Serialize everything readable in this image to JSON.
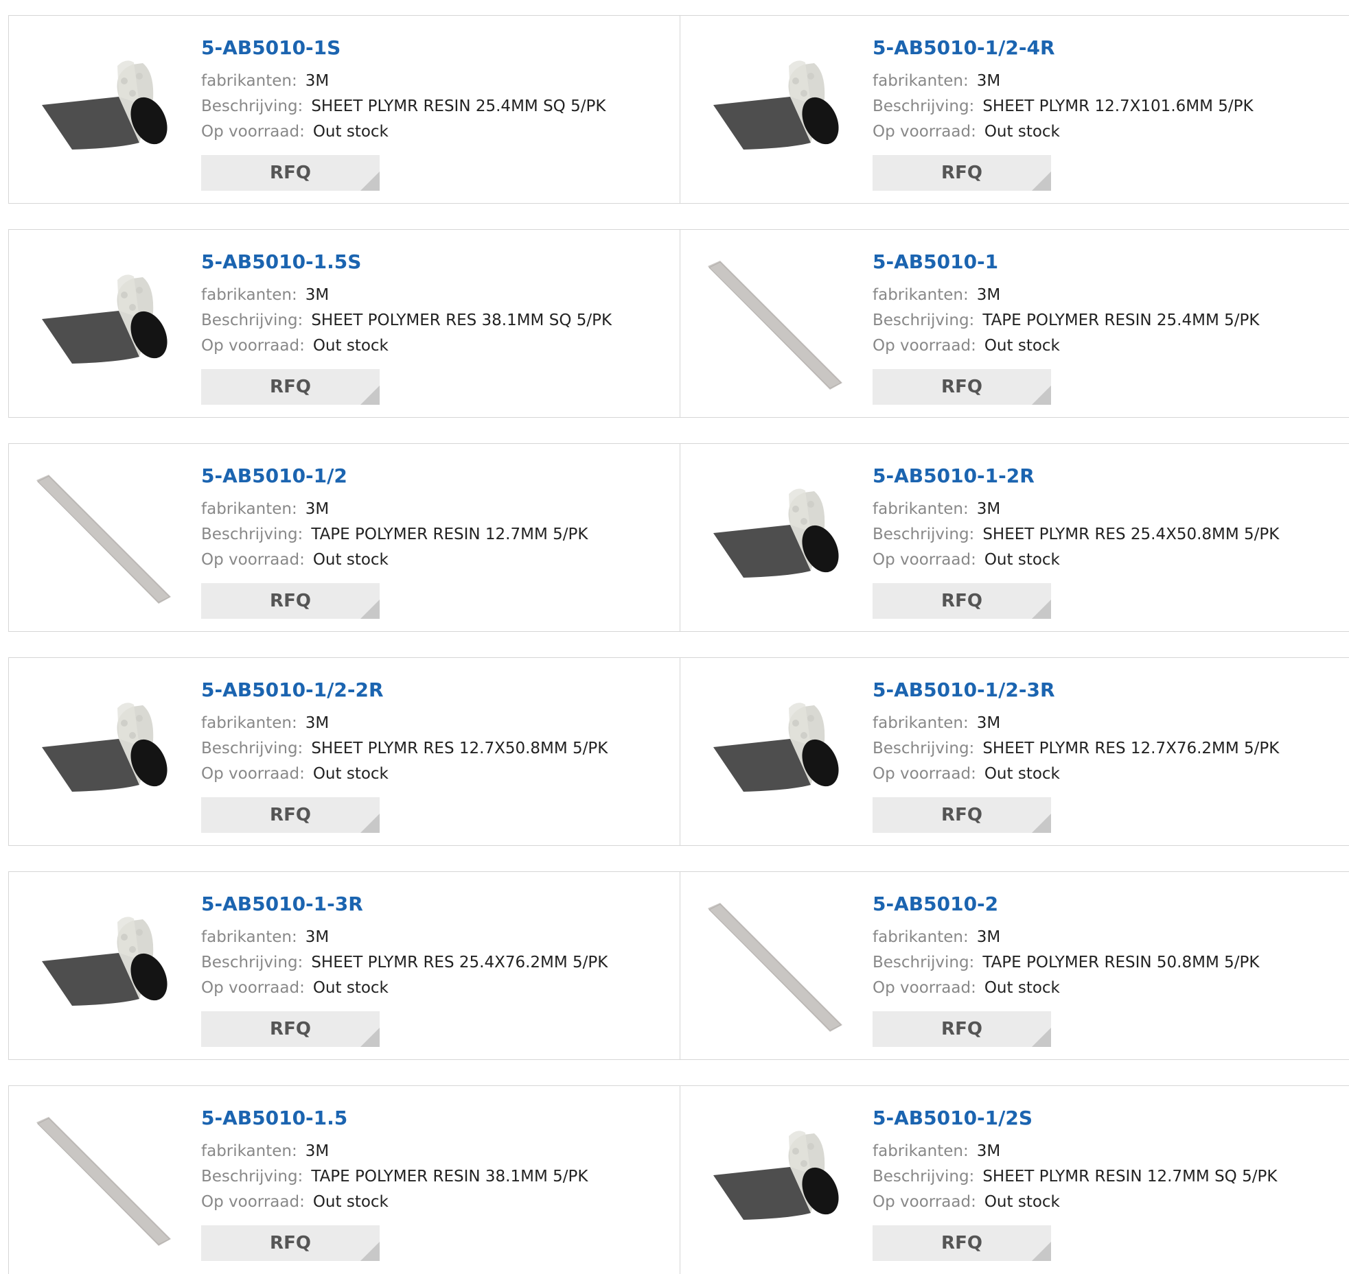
{
  "labels": {
    "manufacturer": "fabrikanten:",
    "description": "Beschrijving:",
    "stock": "Op voorraad:",
    "rfq_button": "RFQ"
  },
  "products": [
    {
      "pn": "5-AB5010-1S",
      "manufacturer": "3M",
      "description": "SHEET PLYMR RESIN 25.4MM SQ 5/PK",
      "stock": "Out stock",
      "image": "sheet-roll"
    },
    {
      "pn": "5-AB5010-1/2-4R",
      "manufacturer": "3M",
      "description": "SHEET PLYMR 12.7X101.6MM 5/PK",
      "stock": "Out stock",
      "image": "sheet-roll"
    },
    {
      "pn": "5-AB5010-1.5S",
      "manufacturer": "3M",
      "description": "SHEET POLYMER RES 38.1MM SQ 5/PK",
      "stock": "Out stock",
      "image": "sheet-roll"
    },
    {
      "pn": "5-AB5010-1",
      "manufacturer": "3M",
      "description": "TAPE POLYMER RESIN 25.4MM 5/PK",
      "stock": "Out stock",
      "image": "tape-strip"
    },
    {
      "pn": "5-AB5010-1/2",
      "manufacturer": "3M",
      "description": "TAPE POLYMER RESIN 12.7MM 5/PK",
      "stock": "Out stock",
      "image": "tape-strip"
    },
    {
      "pn": "5-AB5010-1-2R",
      "manufacturer": "3M",
      "description": "SHEET PLYMR RES 25.4X50.8MM 5/PK",
      "stock": "Out stock",
      "image": "sheet-roll"
    },
    {
      "pn": "5-AB5010-1/2-2R",
      "manufacturer": "3M",
      "description": "SHEET PLYMR RES 12.7X50.8MM 5/PK",
      "stock": "Out stock",
      "image": "sheet-roll"
    },
    {
      "pn": "5-AB5010-1/2-3R",
      "manufacturer": "3M",
      "description": "SHEET PLYMR RES 12.7X76.2MM 5/PK",
      "stock": "Out stock",
      "image": "sheet-roll"
    },
    {
      "pn": "5-AB5010-1-3R",
      "manufacturer": "3M",
      "description": "SHEET PLYMR RES 25.4X76.2MM 5/PK",
      "stock": "Out stock",
      "image": "sheet-roll"
    },
    {
      "pn": "5-AB5010-2",
      "manufacturer": "3M",
      "description": "TAPE POLYMER RESIN 50.8MM 5/PK",
      "stock": "Out stock",
      "image": "tape-strip"
    },
    {
      "pn": "5-AB5010-1.5",
      "manufacturer": "3M",
      "description": "TAPE POLYMER RESIN 38.1MM 5/PK",
      "stock": "Out stock",
      "image": "tape-strip"
    },
    {
      "pn": "5-AB5010-1/2S",
      "manufacturer": "3M",
      "description": "SHEET PLYMR RESIN 12.7MM SQ 5/PK",
      "stock": "Out stock",
      "image": "sheet-roll"
    }
  ],
  "colors": {
    "part_number": "#1b64b0",
    "label": "#888888",
    "value": "#222222",
    "button_bg": "#ebebeb",
    "border": "#d6d6d6"
  }
}
